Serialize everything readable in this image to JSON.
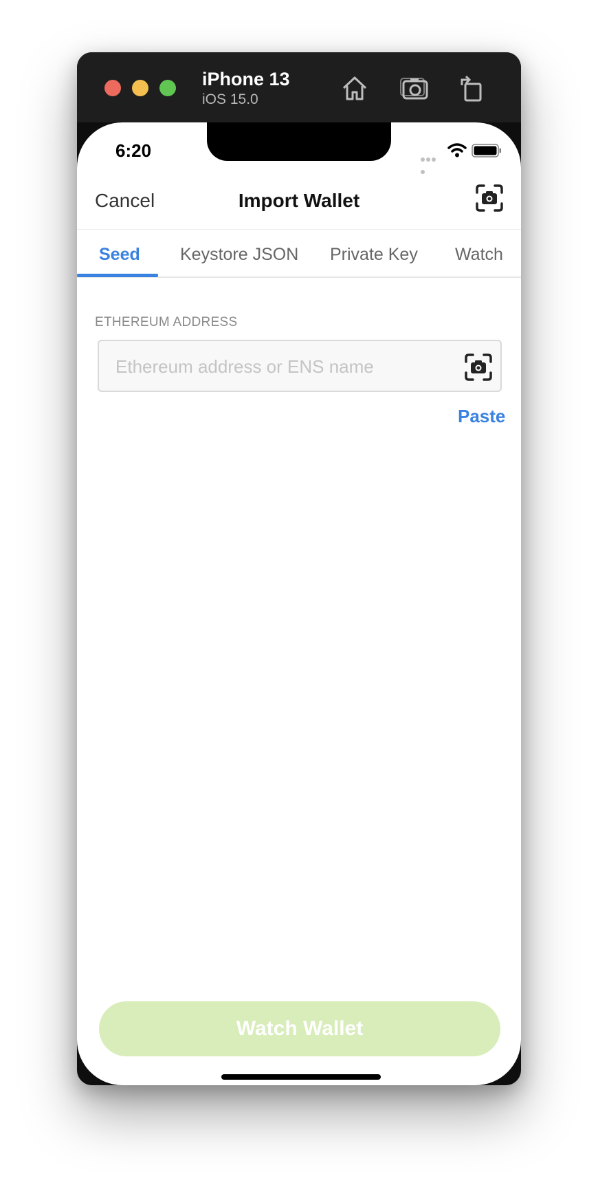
{
  "simulator": {
    "device_name": "iPhone 13",
    "os_version": "iOS 15.0",
    "icons": [
      "home-icon",
      "screenshot-icon",
      "rotate-icon"
    ]
  },
  "status_bar": {
    "time": "6:20"
  },
  "nav": {
    "cancel_label": "Cancel",
    "title": "Import Wallet",
    "scan_icon": "qr-scan-icon"
  },
  "tabs": [
    {
      "label": "Seed",
      "active": true
    },
    {
      "label": "Keystore JSON",
      "active": false
    },
    {
      "label": "Private Key",
      "active": false
    },
    {
      "label": "Watch",
      "active": false
    }
  ],
  "address": {
    "label": "ETHEREUM ADDRESS",
    "placeholder": "Ethereum address or ENS name",
    "value": ""
  },
  "paste_label": "Paste",
  "watch_button_label": "Watch Wallet",
  "colors": {
    "accent": "#3a82e0",
    "button_disabled": "#d8edba"
  }
}
